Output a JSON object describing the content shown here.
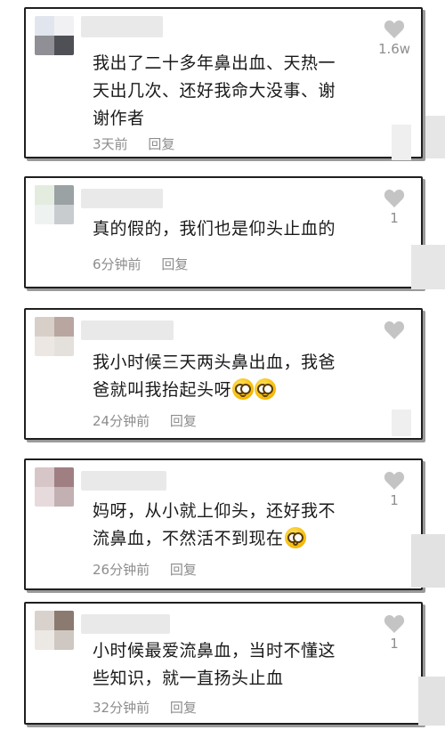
{
  "comments": [
    {
      "text_lines": [
        "我出了二十多年鼻出血、天热一",
        "天出几次、还好我命大没事、谢",
        "谢作者"
      ],
      "time": "3天前",
      "reply": "回复",
      "likes": "1.6w",
      "avatar_colors": [
        "#e1e6ee",
        "#f1f1f3",
        "#8f8f95",
        "#4f4f56"
      ]
    },
    {
      "text_lines": [
        "真的假的，我们也是仰头止血的"
      ],
      "time": "6分钟前",
      "reply": "回复",
      "likes": "1",
      "avatar_colors": [
        "#e4ece0",
        "#9aa2a4",
        "#eef2f0",
        "#c9cccf"
      ]
    },
    {
      "text_lines": [
        "我小时候三天两头鼻出血，我爸",
        "爸就叫我抬起头呀"
      ],
      "time": "24分钟前",
      "reply": "回复",
      "likes": "",
      "avatar_colors": [
        "#d8cfc8",
        "#b9a6a0",
        "#ede7e3",
        "#e4e0dc"
      ]
    },
    {
      "text_lines": [
        "妈呀，从小就上仰头，还好我不",
        "流鼻血，不然活不到现在"
      ],
      "time": "26分钟前",
      "reply": "回复",
      "likes": "1",
      "avatar_colors": [
        "#d7c6c8",
        "#a07f83",
        "#e6dadc",
        "#c2b0b3"
      ]
    },
    {
      "text_lines": [
        "小时候最爱流鼻血，当时不懂这",
        "些知识，就一直扬头止血"
      ],
      "time": "32分钟前",
      "reply": "回复",
      "likes": "1",
      "avatar_colors": [
        "#d9d2cc",
        "#8b7a70",
        "#ece8e4",
        "#cfc8c2"
      ]
    }
  ],
  "icons": {
    "like": "heart-icon",
    "emoji_grin": "grinning-face-emoji",
    "emoji_shock": "astonished-face-emoji"
  },
  "colors": {
    "text": "#1a1a1a",
    "meta": "#8d8d8d",
    "heart": "#c4c4c4"
  }
}
